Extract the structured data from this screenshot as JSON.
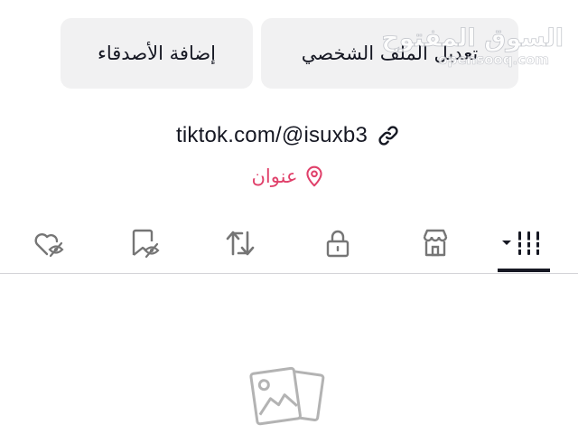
{
  "profile_actions": {
    "add_friends_label": "إضافة الأصدقاء",
    "edit_profile_label": "تعديل الملف الشخصي"
  },
  "watermark": {
    "arabic": "السوق المفتوح",
    "latin": "opensooq.com"
  },
  "profile": {
    "link": "tiktok.com/@isuxb3",
    "location": "عنوان"
  },
  "tabs": [
    {
      "icon": "grid-icon",
      "active": true
    },
    {
      "icon": "shop-icon",
      "active": false
    },
    {
      "icon": "lock-icon",
      "active": false
    },
    {
      "icon": "repost-icon",
      "active": false
    },
    {
      "icon": "favorites-hidden-icon",
      "active": false
    },
    {
      "icon": "liked-hidden-icon",
      "active": false
    }
  ],
  "colors": {
    "text": "#161823",
    "accent": "#e0406a",
    "button_bg": "#f1f1f2",
    "icon_gray": "#757575"
  }
}
